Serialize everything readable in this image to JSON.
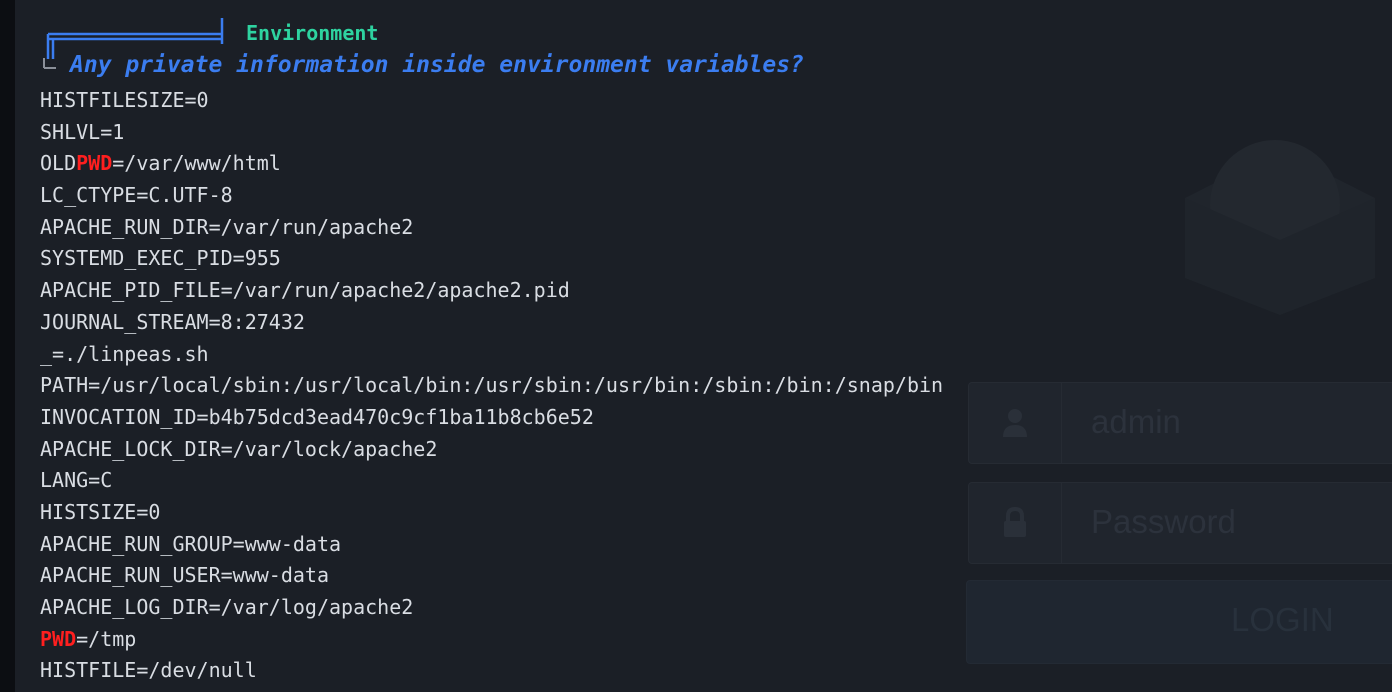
{
  "background_login": {
    "username_placeholder": "admin",
    "password_placeholder": "Password",
    "login_button_label": "LOGIN",
    "icons": [
      "user-icon",
      "lock-icon",
      "logo-icon"
    ]
  },
  "section": {
    "title": "Environment",
    "question": "Any private information inside environment variables?"
  },
  "env_lines": [
    {
      "pre": "HISTFILESIZE=0",
      "hl": "",
      "post": ""
    },
    {
      "pre": "SHLVL=1",
      "hl": "",
      "post": ""
    },
    {
      "pre": "OLD",
      "hl": "PWD",
      "post": "=/var/www/html"
    },
    {
      "pre": "LC_CTYPE=C.UTF-8",
      "hl": "",
      "post": ""
    },
    {
      "pre": "APACHE_RUN_DIR=/var/run/apache2",
      "hl": "",
      "post": ""
    },
    {
      "pre": "SYSTEMD_EXEC_PID=955",
      "hl": "",
      "post": ""
    },
    {
      "pre": "APACHE_PID_FILE=/var/run/apache2/apache2.pid",
      "hl": "",
      "post": ""
    },
    {
      "pre": "JOURNAL_STREAM=8:27432",
      "hl": "",
      "post": ""
    },
    {
      "pre": "_=./linpeas.sh",
      "hl": "",
      "post": ""
    },
    {
      "pre": "PATH=/usr/local/sbin:/usr/local/bin:/usr/sbin:/usr/bin:/sbin:/bin:/snap/bin",
      "hl": "",
      "post": ""
    },
    {
      "pre": "INVOCATION_ID=b4b75dcd3ead470c9cf1ba11b8cb6e52",
      "hl": "",
      "post": ""
    },
    {
      "pre": "APACHE_LOCK_DIR=/var/lock/apache2",
      "hl": "",
      "post": ""
    },
    {
      "pre": "LANG=C",
      "hl": "",
      "post": ""
    },
    {
      "pre": "HISTSIZE=0",
      "hl": "",
      "post": ""
    },
    {
      "pre": "APACHE_RUN_GROUP=www-data",
      "hl": "",
      "post": ""
    },
    {
      "pre": "APACHE_RUN_USER=www-data",
      "hl": "",
      "post": ""
    },
    {
      "pre": "APACHE_LOG_DIR=/var/log/apache2",
      "hl": "",
      "post": ""
    },
    {
      "pre": "",
      "hl": "PWD",
      "post": "=/tmp"
    },
    {
      "pre": "HISTFILE=/dev/null",
      "hl": "",
      "post": ""
    }
  ],
  "colors": {
    "background": "#1b1f26",
    "text": "#d9dde3",
    "title": "#2ed3a0",
    "question": "#3b7df0",
    "highlight": "#ff1f1f"
  }
}
